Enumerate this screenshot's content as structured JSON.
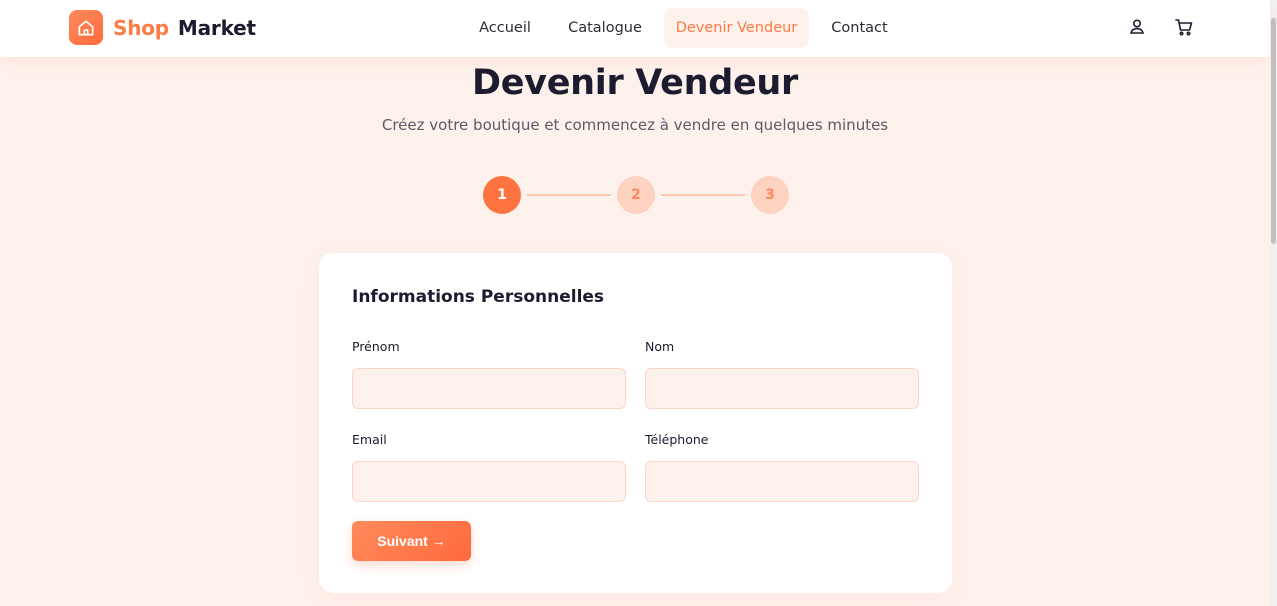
{
  "header": {
    "brand": {
      "part1": "Shop",
      "part2": "Market",
      "icon": "home-icon"
    },
    "nav": [
      {
        "label": "Accueil",
        "active": false
      },
      {
        "label": "Catalogue",
        "active": false
      },
      {
        "label": "Devenir Vendeur",
        "active": true
      },
      {
        "label": "Contact",
        "active": false
      }
    ],
    "icons": [
      "user-icon",
      "cart-icon"
    ]
  },
  "hero": {
    "title": "Devenir Vendeur",
    "subtitle": "Créez votre boutique et commencez à vendre en quelques minutes"
  },
  "stepper": {
    "current": 1,
    "steps": [
      "1",
      "2",
      "3"
    ]
  },
  "form": {
    "title": "Informations Personnelles",
    "fields": {
      "prenom": {
        "label": "Prénom",
        "value": "",
        "placeholder": ""
      },
      "nom": {
        "label": "Nom",
        "value": "",
        "placeholder": ""
      },
      "email": {
        "label": "Email",
        "value": "",
        "placeholder": ""
      },
      "telephone": {
        "label": "Téléphone",
        "value": "",
        "placeholder": ""
      }
    },
    "next_button": "Suivant →"
  },
  "colors": {
    "accent": "#ff7340",
    "background": "#fdf1ec",
    "text": "#1d1b2f",
    "step_inactive": "#fdd2c1"
  }
}
